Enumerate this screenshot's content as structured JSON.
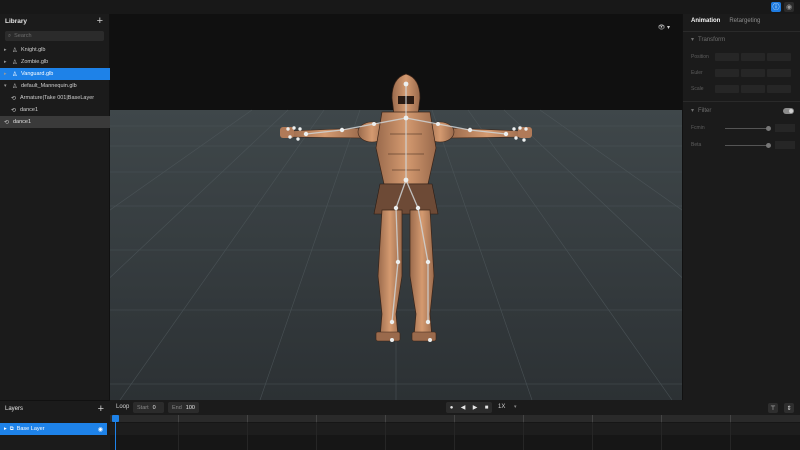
{
  "library": {
    "title": "Library",
    "search_placeholder": "Search",
    "items": [
      {
        "label": "Knight.glb",
        "icon": "person-icon"
      },
      {
        "label": "Zombie.glb",
        "icon": "person-icon"
      },
      {
        "label": "Vanguard.glb",
        "icon": "person-icon"
      },
      {
        "label": "default_Mannequin.glb",
        "icon": "person-icon"
      },
      {
        "label": "Armature|Take 001|BaseLayer",
        "icon": "animation-icon"
      },
      {
        "label": "dance1",
        "icon": "animation-icon"
      },
      {
        "label": "dance1",
        "icon": "animation-icon"
      }
    ]
  },
  "layers": {
    "title": "Layers",
    "items": [
      {
        "label": "Base Layer"
      }
    ]
  },
  "inspector": {
    "tabs": [
      "Animation",
      "Retargeting"
    ],
    "transform_title": "Transform",
    "position_label": "Position",
    "rotation_label": "Euler",
    "scale_label": "Scale",
    "filter_title": "Filter",
    "filter_a_label": "Fcmin",
    "filter_b_label": "Beta"
  },
  "transport": {
    "loop_label": "Loop",
    "start_label": "Start",
    "start_value": "0",
    "end_label": "End",
    "end_value": "100",
    "speed": "1X"
  },
  "colors": {
    "accent": "#1e82e8",
    "model_color": "#c48a63"
  }
}
